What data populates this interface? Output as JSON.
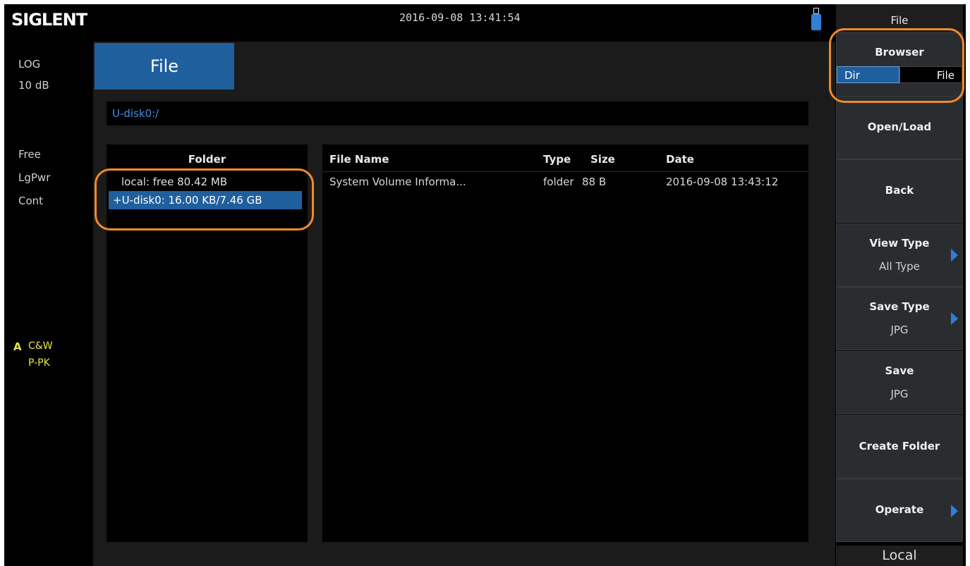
{
  "header": {
    "brand": "SIGLENT",
    "datetime": "2016-09-08  13:41:54"
  },
  "left_status": {
    "scale_type": "LOG",
    "scale_div": "10 dB",
    "trigger": "Free",
    "detector": "LgPwr",
    "sweep": "Cont",
    "trace_letter": "A",
    "trace_mode": "C&W",
    "trace_detector": "P-PK"
  },
  "main": {
    "tab_label": "File",
    "path": "U-disk0:/",
    "folder_header": "Folder",
    "folders": [
      "local: free 80.42 MB",
      "+U-disk0: 16.00 KB/7.46 GB"
    ],
    "columns": {
      "name": "File Name",
      "type": "Type",
      "size": "Size",
      "date": "Date"
    },
    "files": [
      {
        "name": "System Volume Informa...",
        "type": "folder",
        "size": "88 B",
        "date": "2016-09-08 13:43:12"
      }
    ]
  },
  "menu": {
    "title": "File",
    "browser": {
      "label": "Browser",
      "opt_dir": "Dir",
      "opt_file": "File",
      "selected": "Dir"
    },
    "open_load": "Open/Load",
    "back": "Back",
    "view_type": {
      "label": "View Type",
      "value": "All Type"
    },
    "save_type": {
      "label": "Save Type",
      "value": "JPG"
    },
    "save": {
      "label": "Save",
      "value": "JPG"
    },
    "create_folder": "Create Folder",
    "operate": "Operate",
    "bottom": "Local"
  },
  "colors": {
    "accent": "#1f5f9e",
    "annotation": "#f08a2a",
    "path_text": "#3a8fe8",
    "trace_yellow": "#e6e63c"
  }
}
